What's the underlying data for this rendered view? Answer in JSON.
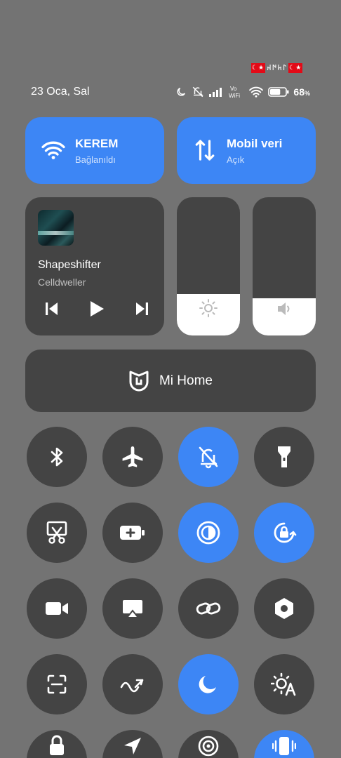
{
  "status_bar": {
    "carrier_text": "𐰃𐱅𐰇𐰴",
    "date": "23 Oca, Sal",
    "battery_percent": "68",
    "battery_unit": "%",
    "battery_level": 0.68,
    "icons": [
      "moon-icon",
      "mute-icon",
      "signal-icon",
      "vowifi-icon",
      "wifi-icon",
      "battery-icon"
    ],
    "vowifi_top": "Vo",
    "vowifi_bottom": "WiFi"
  },
  "wifi_tile": {
    "title": "KEREM",
    "subtitle": "Bağlanıldı",
    "icon": "wifi-icon",
    "active": true
  },
  "mobile_data_tile": {
    "title": "Mobil veri",
    "subtitle": "Açık",
    "icon": "data-arrows-icon",
    "active": true
  },
  "media": {
    "title": "Shapeshifter",
    "artist": "Celldweller",
    "controls": [
      "previous-icon",
      "play-icon",
      "next-icon"
    ]
  },
  "brightness": {
    "icon": "sun-icon",
    "level": 0.3
  },
  "volume": {
    "icon": "speaker-icon",
    "level": 0.27
  },
  "mi_home": {
    "label": "Mi Home",
    "icon": "mi-home-icon"
  },
  "toggles": [
    {
      "name": "bluetooth",
      "icon": "bluetooth-icon",
      "active": false
    },
    {
      "name": "airplane",
      "icon": "airplane-icon",
      "active": false
    },
    {
      "name": "mute",
      "icon": "bell-off-icon",
      "active": true
    },
    {
      "name": "flashlight",
      "icon": "flashlight-icon",
      "active": false
    },
    {
      "name": "screenshot",
      "icon": "scissors-icon",
      "active": false
    },
    {
      "name": "battery-saver",
      "icon": "battery-plus-icon",
      "active": false
    },
    {
      "name": "reading-mode",
      "icon": "contrast-icon",
      "active": true
    },
    {
      "name": "rotation-lock",
      "icon": "rotation-lock-icon",
      "active": true
    },
    {
      "name": "video",
      "icon": "video-camera-icon",
      "active": false
    },
    {
      "name": "cast",
      "icon": "cast-icon",
      "active": false
    },
    {
      "name": "link",
      "icon": "link-icon",
      "active": false
    },
    {
      "name": "settings",
      "icon": "hexagon-settings-icon",
      "active": false
    },
    {
      "name": "scanner",
      "icon": "scan-icon",
      "active": false
    },
    {
      "name": "sync",
      "icon": "sync-icon",
      "active": false
    },
    {
      "name": "dark-mode",
      "icon": "moon-icon",
      "active": true
    },
    {
      "name": "auto-brightness",
      "icon": "auto-brightness-icon",
      "active": false
    },
    {
      "name": "lock",
      "icon": "lock-icon",
      "active": false
    },
    {
      "name": "location",
      "icon": "location-arrow-icon",
      "active": false
    },
    {
      "name": "hotspot",
      "icon": "hotspot-icon",
      "active": false
    },
    {
      "name": "vibrate",
      "icon": "vibrate-icon",
      "active": true
    }
  ],
  "colors": {
    "accent": "#3d86f5",
    "tile_dark": "#444444",
    "background": "#737373"
  }
}
